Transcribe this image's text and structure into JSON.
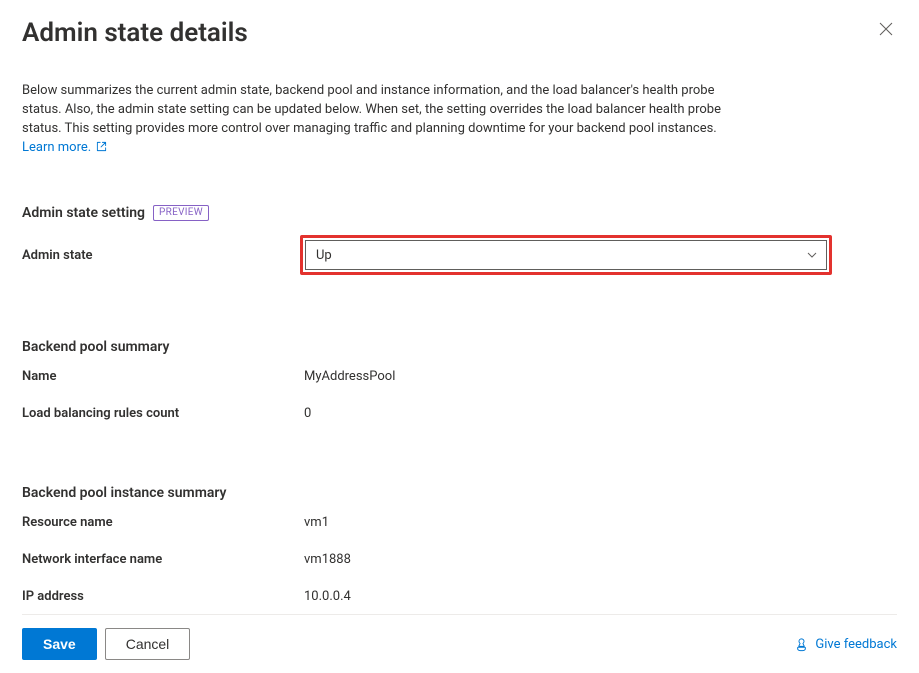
{
  "header": {
    "title": "Admin state details"
  },
  "intro": {
    "text": "Below summarizes the current admin state, backend pool and instance information, and the load balancer's health probe status. Also, the admin state setting can be updated below. When set, the setting overrides the load balancer health probe status. This setting provides more control over managing traffic and planning downtime for your backend pool instances.",
    "learn_more": "Learn more."
  },
  "admin_state_section": {
    "heading": "Admin state setting",
    "badge": "PREVIEW",
    "label": "Admin state",
    "value": "Up"
  },
  "backend_pool_summary": {
    "heading": "Backend pool summary",
    "rows": [
      {
        "label": "Name",
        "value": "MyAddressPool"
      },
      {
        "label": "Load balancing rules count",
        "value": "0"
      }
    ]
  },
  "instance_summary": {
    "heading": "Backend pool instance summary",
    "rows": [
      {
        "label": "Resource name",
        "value": "vm1"
      },
      {
        "label": "Network interface name",
        "value": "vm1888"
      },
      {
        "label": "IP address",
        "value": "10.0.0.4"
      }
    ]
  },
  "footer": {
    "save": "Save",
    "cancel": "Cancel",
    "feedback": "Give feedback"
  }
}
